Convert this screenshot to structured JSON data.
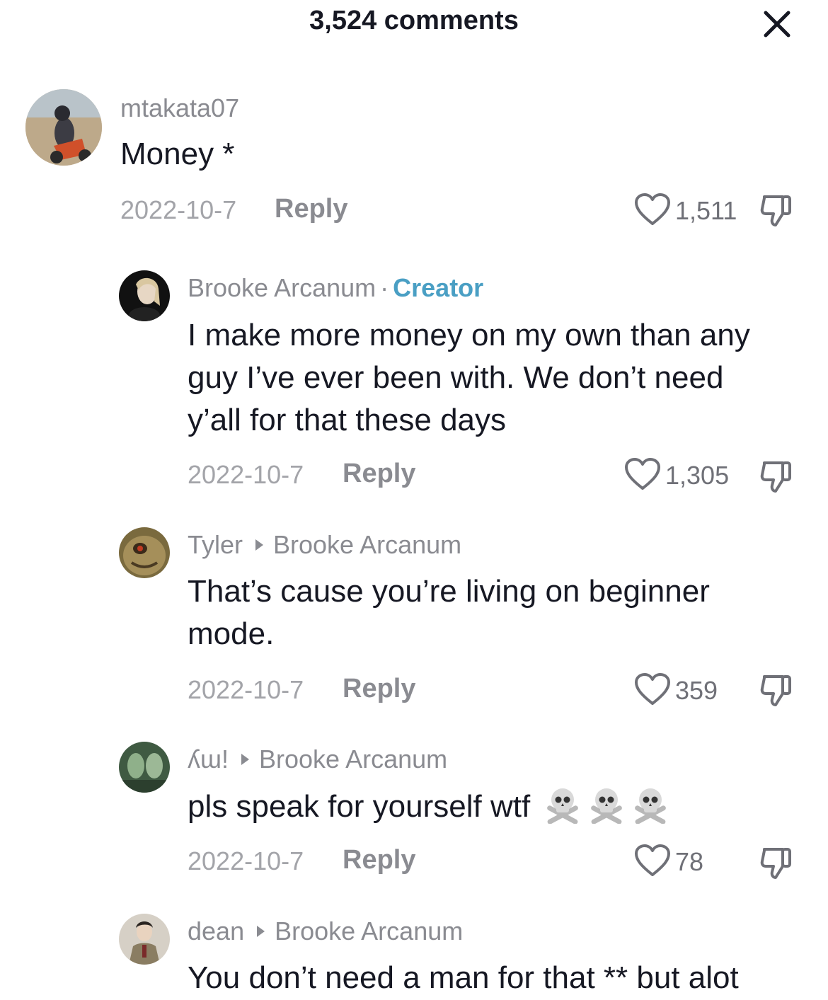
{
  "header": {
    "title": "3,524 comments",
    "close_icon": "close-icon"
  },
  "comments": [
    {
      "username": "mtakata07",
      "text": "Money *",
      "date": "2022-10-7",
      "reply_label": "Reply",
      "likes": "1,511"
    },
    {
      "username": "Brooke Arcanum",
      "separator": "·",
      "badge": "Creator",
      "text_lines": [
        "I make more money on my own than any",
        "guy I’ve ever been with. We don’t need",
        "y’all for that these days"
      ],
      "date": "2022-10-7",
      "reply_label": "Reply",
      "likes": "1,305"
    },
    {
      "username": "Tyler",
      "reply_to": "Brooke Arcanum",
      "text_lines": [
        "That’s cause you’re living on beginner",
        "mode."
      ],
      "date": "2022-10-7",
      "reply_label": "Reply",
      "likes": "359"
    },
    {
      "username": "ʎɯ!",
      "reply_to": "Brooke Arcanum",
      "text": "pls speak for yourself wtf",
      "emojis": [
        "skull-and-crossbones",
        "skull-and-crossbones",
        "skull-and-crossbones"
      ],
      "date": "2022-10-7",
      "reply_label": "Reply",
      "likes": "78"
    },
    {
      "username": "dean",
      "reply_to": "Brooke Arcanum",
      "text": "You don’t need a man for that ** but alot"
    }
  ],
  "colors": {
    "username": "#8a8b91",
    "creator_badge": "#4a9fc4",
    "text": "#161823",
    "meta": "#a3a4a9"
  }
}
